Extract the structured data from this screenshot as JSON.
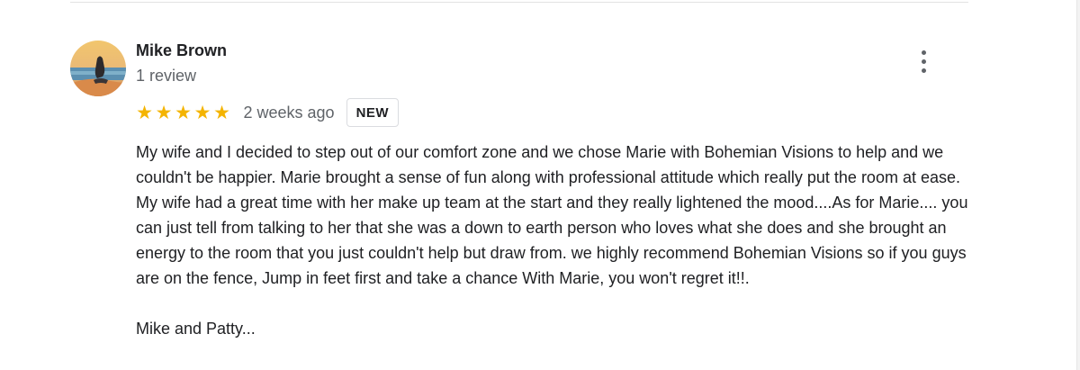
{
  "review": {
    "author": "Mike Brown",
    "review_count": "1 review",
    "rating": 5,
    "stars": [
      "★",
      "★",
      "★",
      "★",
      "★"
    ],
    "time_ago": "2 weeks ago",
    "badge": "NEW",
    "text_paragraphs": [
      "My wife and I decided to step out of our comfort zone and we chose Marie with Bohemian Visions to help and we couldn't be happier. Marie brought a sense of fun along with professional attitude which really put the room at ease. My wife had a great time with her make up team at the start and they really lightened the mood....As for Marie.... you can just tell from talking to her that she was a down to earth person who loves what she does and she brought an energy to the room that you just couldn't help but draw from. we highly recommend Bohemian Visions so if you guys are on the fence, Jump in feet first and take a chance With Marie, you won't regret it!!.",
      "Mike and Patty..."
    ]
  },
  "icons": {
    "avatar": "avatar-photo-icon",
    "more": "more-vert-icon",
    "star": "star-icon"
  },
  "colors": {
    "star": "#f4b400",
    "secondary_text": "#5f6368",
    "primary_text": "#202124"
  }
}
